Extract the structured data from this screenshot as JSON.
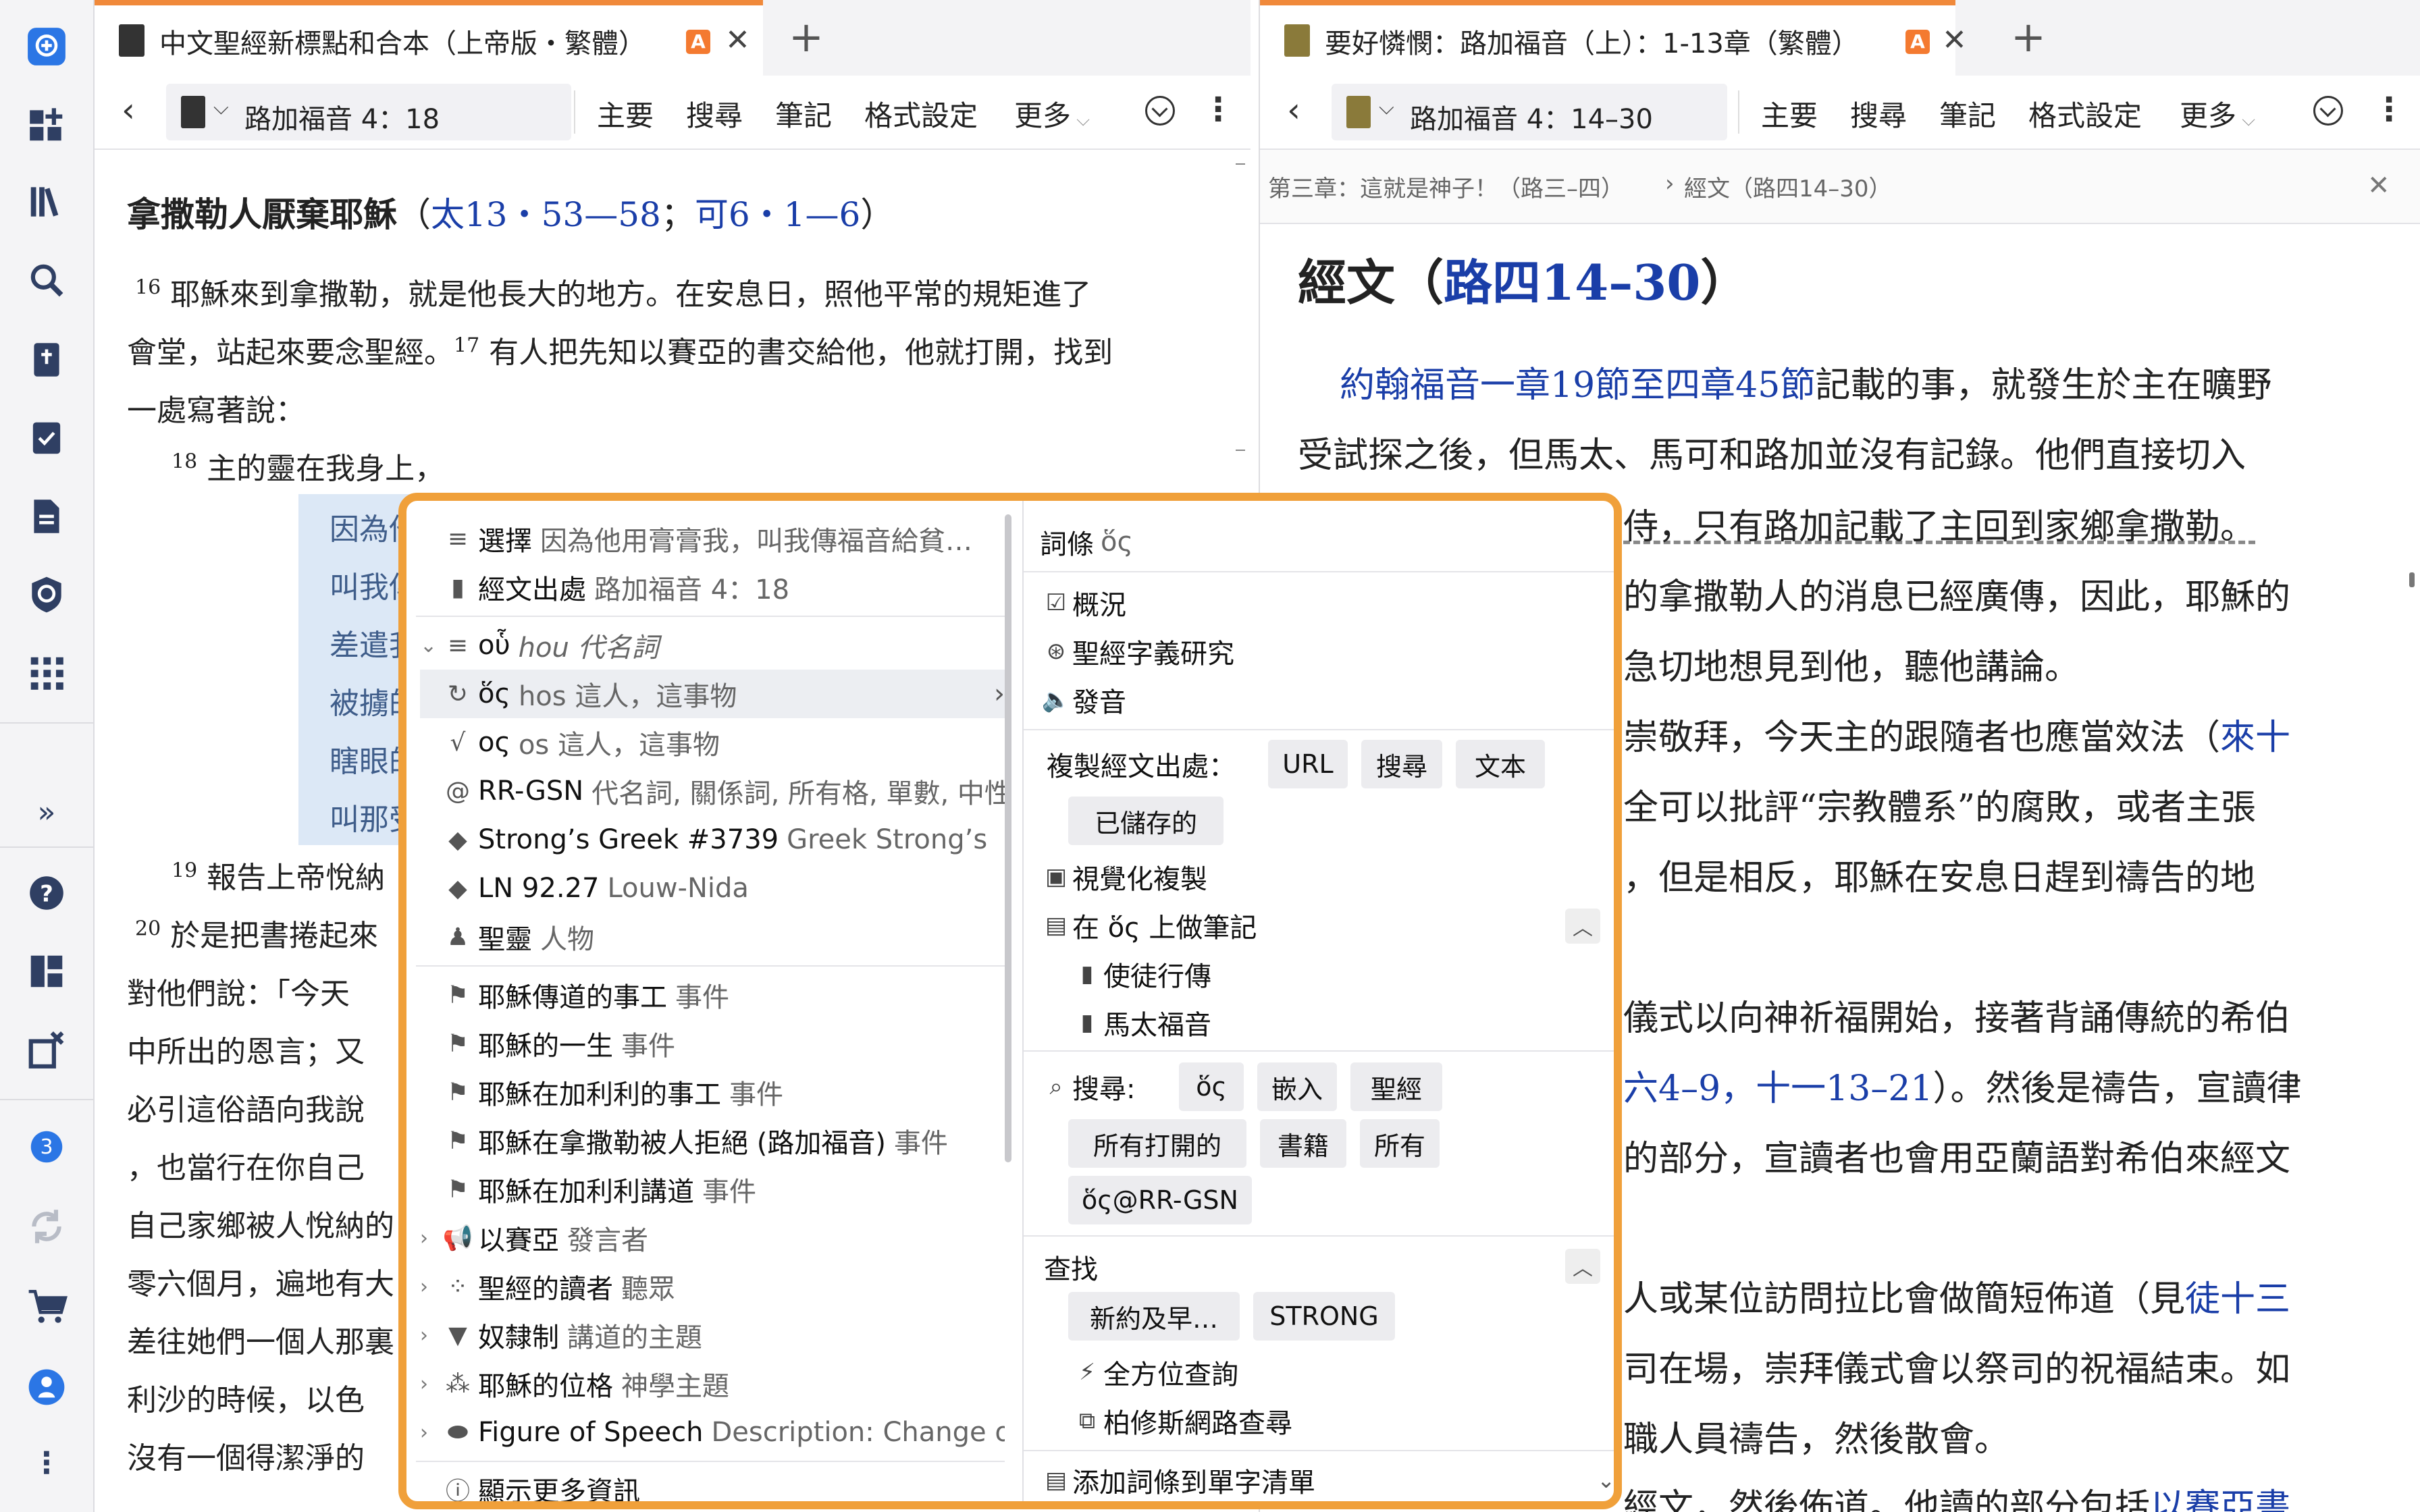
{
  "left_pane": {
    "tab_title": "中文聖經新標點和合本（上帝版・繁體）",
    "tab_badge": "A",
    "reference": "路加福音 4：18",
    "toolbar": {
      "main": "主要",
      "search": "搜尋",
      "notes": "筆記",
      "format": "格式設定",
      "more": "更多"
    },
    "heading": "拿撒勒人厭棄耶穌",
    "heading_refs": {
      "open": "（",
      "ref1": "太13・53—58",
      "sep": "；",
      "ref2": "可6・1—6",
      "close": "）"
    },
    "lines": [
      {
        "vn": "16",
        "text": " 耶穌來到拿撒勒，就是他長大的地方。在安息日，照他平常的規矩進了"
      },
      {
        "text": "會堂，站起來要念聖經。"
      },
      {
        "vn": "17",
        "text": " 有人把先知以賽亞的書交給他，他就打開，找到"
      },
      {
        "text": "一處寫著說："
      },
      {
        "vn": "18",
        "text": " 主的靈在我身上，"
      }
    ],
    "highlight_lines": [
      "因為他用膏",
      "叫我傳福音",
      "差遣我報告",
      "被擄的得釋",
      "瞎眼的得看",
      "叫那受壓制"
    ],
    "lower_lines": [
      {
        "vn": "19",
        "text": " 報告上帝悅納"
      },
      {
        "vn": "20",
        "text": " 於是把書捲起來"
      },
      {
        "text": "對他們說：「今天"
      },
      {
        "text": "中所出的恩言；又"
      },
      {
        "text": "必引這俗語向我說"
      },
      {
        "text": "，也當行在你自己"
      },
      {
        "text": "自己家鄉被人悅納的"
      },
      {
        "text": "零六個月，遍地有大"
      },
      {
        "text": "差往她們一個人那裏"
      },
      {
        "text": "利沙的時候，以色"
      },
      {
        "text": "沒有一個得潔淨的"
      }
    ]
  },
  "right_pane": {
    "tab_title": "要好憐憫：路加福音（上）：1-13章（繁體）",
    "tab_badge": "A",
    "reference": "路加福音 4：14–30",
    "toolbar": {
      "main": "主要",
      "search": "搜尋",
      "notes": "筆記",
      "format": "格式設定",
      "more": "更多"
    },
    "breadcrumb": [
      "第三章：這就是神子！（路三–四）",
      "經文（路四14–30）"
    ],
    "heading_prefix": "經文（",
    "heading_link": "路四14–30",
    "heading_suffix": "）",
    "para1_link": "約翰福音一章19節至四章45節",
    "para1_rest": "記載的事，就發生於主在曠野",
    "lines": [
      "受試探之後，但馬太、馬可和路加並沒有記錄。他們直接切入",
      "侍，只有路加記載了主回到家鄉拿撒勒。",
      "的拿撒勒人的消息已經廣傳，因此，耶穌的",
      "急切地想見到他，聽他講論。",
      "崇敬拜，今天主的跟隨者也應當效法（",
      "全可以批評“宗教體系”的腐敗，或者主張",
      "，但是相反，耶穌在安息日趕到禱告的地",
      "儀式以向神祈福開始，接著背誦傳統的希伯",
      "）。然後是禱告，宣讀律",
      "的部分，宣讀者也會用亞蘭語對希伯來經文",
      "人或某位訪問拉比會做簡短佈道（見",
      "司在場，崇拜儀式會以祭司的祝福結束。如",
      "職人員禱告，然後散會。",
      "經文，然後佈道。他讀的部分包括"
    ],
    "links": {
      "lai": "來十",
      "refs": "六4–9，十一13–21",
      "tu": "徒十三",
      "yisaiya": "以賽亞書"
    }
  },
  "popup": {
    "left_items": [
      {
        "icon": "lines-icon",
        "main": "選擇",
        "sub": "因為他用膏膏我，叫我傳福音給貧…"
      },
      {
        "icon": "bookmark-icon",
        "main": "經文出處",
        "sub": "路加福音 4：18"
      },
      {
        "icon": "lines-icon",
        "main": "οὗ",
        "sub": "hou 代名詞",
        "chev": "⌄"
      },
      {
        "icon": "cycle-icon",
        "main": "ὅς",
        "sub": "hos 這人，這事物",
        "arrow": "›"
      },
      {
        "icon": "root-icon",
        "main": "ος",
        "sub": "os 這人，這事物"
      },
      {
        "icon": "at-icon",
        "main": "RR-GSN",
        "sub": "代名詞, 關係詞, 所有格, 單數, 中性"
      },
      {
        "icon": "diamond-icon",
        "main": "Strong’s Greek #3739",
        "sub": "Greek Strong’s"
      },
      {
        "icon": "diamond-icon",
        "main": "LN 92.27",
        "sub": "Louw-Nida"
      },
      {
        "icon": "person-icon",
        "main": "聖靈",
        "sub": "人物"
      },
      {
        "icon": "flag-icon",
        "main": "耶穌傳道的事工",
        "sub": "事件"
      },
      {
        "icon": "flag-icon",
        "main": "耶穌的一生",
        "sub": "事件"
      },
      {
        "icon": "flag-icon",
        "main": "耶穌在加利利的事工",
        "sub": "事件"
      },
      {
        "icon": "flag-icon",
        "main": "耶穌在拿撒勒被人拒絕 (路加福音)",
        "sub": "事件"
      },
      {
        "icon": "flag-icon",
        "main": "耶穌在加利利講道",
        "sub": "事件"
      },
      {
        "icon": "megaphone-icon",
        "main": "以賽亞",
        "sub": "發言者",
        "chev": "›"
      },
      {
        "icon": "audience-icon",
        "main": "聖經的讀者",
        "sub": "聽眾",
        "chev": "›"
      },
      {
        "icon": "topic-icon",
        "main": "奴隸制",
        "sub": "講道的主題",
        "chev": "›"
      },
      {
        "icon": "theology-icon",
        "main": "耶穌的位格",
        "sub": "神學主題",
        "chev": "›"
      },
      {
        "icon": "tag-icon",
        "main": "Figure of Speech",
        "sub": "Description: Change of No…",
        "chev": "›"
      }
    ],
    "show_more": "顯示更多資訊",
    "right": {
      "title": "詞條",
      "title_word": "ὅς",
      "overview": "概況",
      "word_study": "聖經字義研究",
      "pronounce": "發音",
      "copy_label": "複製經文出處：",
      "copy_chips": [
        "URL",
        "搜尋",
        "文本",
        "已儲存的"
      ],
      "visual_copy": "視覺化複製",
      "note_on": "在 ὅς 上做筆記",
      "notebooks": [
        "使徒行傳",
        "馬太福音"
      ],
      "search_label": "搜尋:",
      "search_chips": [
        "ὅς",
        "嵌入",
        "聖經",
        "所有打開的",
        "書籍",
        "所有",
        "ὅς@RR-GSN"
      ],
      "find_label": "查找",
      "find_chips": [
        "新約及早…",
        "STRONG"
      ],
      "omni": "全方位查詢",
      "perseus": "柏修斯網路查尋",
      "add_wordlist": "添加詞條到單字清單"
    }
  },
  "rail": {
    "badge_count": "3"
  },
  "colors": {
    "accent": "#f0893a",
    "popup_border": "#f0a03a",
    "link": "#1a3ea8",
    "rail_icon": "#2f3f63",
    "highlight": "#dce8f6"
  }
}
